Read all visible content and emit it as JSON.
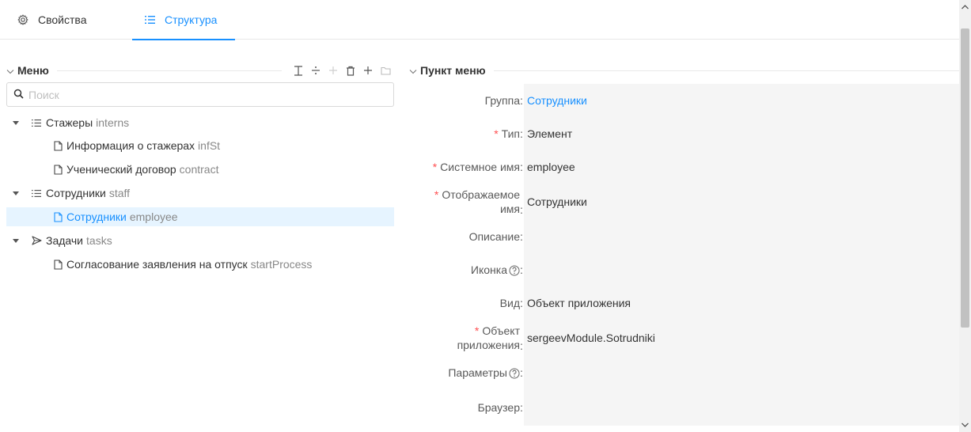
{
  "tabs": [
    {
      "label": "Свойства",
      "icon": "gear-icon",
      "active": false
    },
    {
      "label": "Структура",
      "icon": "list-icon",
      "active": true
    }
  ],
  "menu_section": {
    "title": "Меню",
    "toolbar": [
      "text-cursor-icon",
      "divide-icon",
      "plus-disabled-icon",
      "trash-icon",
      "plus-icon",
      "folder-icon"
    ],
    "search_placeholder": "Поиск"
  },
  "tree": [
    {
      "label": "Стажеры",
      "code": "interns",
      "type": "group",
      "expanded": true,
      "level": 0
    },
    {
      "label": "Информация о стажерах",
      "code": "infSt",
      "type": "item",
      "level": 1
    },
    {
      "label": "Ученический договор",
      "code": "contract",
      "type": "item",
      "level": 1
    },
    {
      "label": "Сотрудники",
      "code": "staff",
      "type": "group",
      "expanded": true,
      "level": 0
    },
    {
      "label": "Сотрудники",
      "code": "employee",
      "type": "item",
      "level": 1,
      "selected": true
    },
    {
      "label": "Задачи",
      "code": "tasks",
      "type": "tasks",
      "expanded": true,
      "level": 0
    },
    {
      "label": "Согласование заявления на отпуск",
      "code": "startProcess",
      "type": "item",
      "level": 1
    }
  ],
  "item_section": {
    "title": "Пункт меню",
    "fields": {
      "group": {
        "label": "Группа",
        "value": "Сотрудники"
      },
      "type": {
        "label": "Тип",
        "value": "Элемент"
      },
      "system_name": {
        "label": "Системное имя",
        "value": "employee"
      },
      "display_name": {
        "label_line1": "Отображаемое",
        "label_line2": "имя",
        "value": "Сотрудники"
      },
      "description": {
        "label": "Описание",
        "value": ""
      },
      "icon": {
        "label": "Иконка",
        "value": ""
      },
      "view": {
        "label": "Вид",
        "value": "Объект приложения"
      },
      "app_object": {
        "label_line1": "Объект",
        "label_line2": "приложения",
        "value": "sergeevModule.Sotrudniki"
      },
      "params": {
        "label": "Параметры",
        "value": ""
      },
      "browser": {
        "label": "Браузер",
        "value": ""
      }
    }
  },
  "colors": {
    "accent": "#1890ff",
    "required": "#ff4d4f",
    "selected_bg": "#e6f4ff",
    "field_bg": "#f5f5f5"
  }
}
